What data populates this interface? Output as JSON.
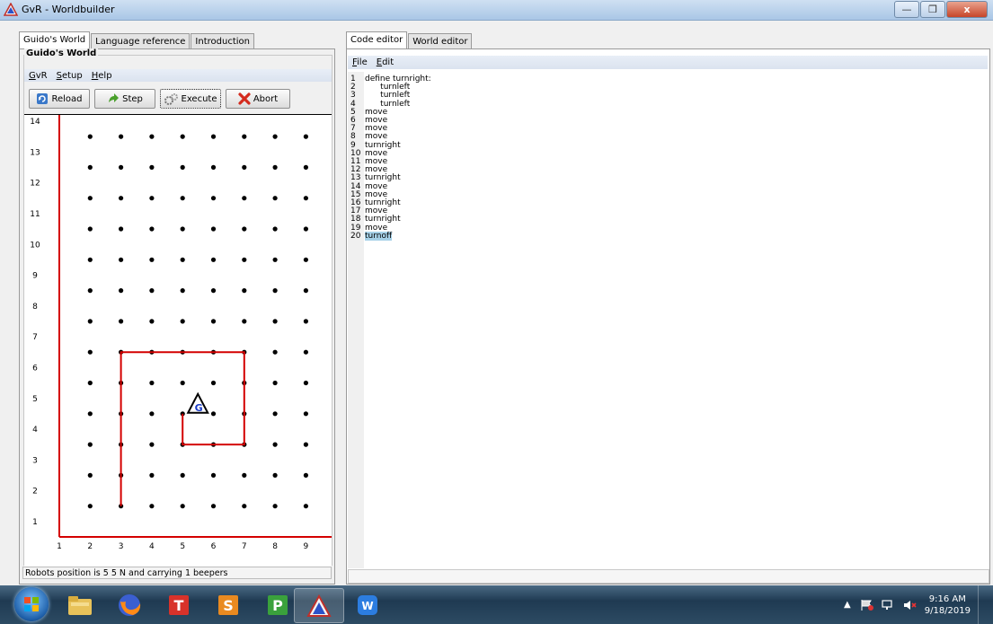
{
  "window": {
    "title": "GvR - Worldbuilder",
    "controls": [
      "—",
      "❒",
      "x"
    ]
  },
  "left_tabs": [
    {
      "label": "Guido's World",
      "active": true
    },
    {
      "label": "Language reference",
      "active": false
    },
    {
      "label": "Introduction",
      "active": false
    }
  ],
  "world_group": {
    "title": "Guido's World",
    "menu": [
      "GvR",
      "Setup",
      "Help"
    ],
    "toolbar": {
      "reload": "Reload",
      "step": "Step",
      "execute": "Execute",
      "abort": "Abort"
    },
    "grid": {
      "x_labels": [
        "1",
        "2",
        "3",
        "4",
        "5",
        "6",
        "7",
        "8",
        "9"
      ],
      "y_labels": [
        "1",
        "2",
        "3",
        "4",
        "5",
        "6",
        "7",
        "8",
        "9",
        "10",
        "11",
        "12",
        "13",
        "14"
      ],
      "robot_label": "G",
      "robot_heading": "N",
      "robot_position": [
        5,
        5
      ],
      "path": [
        [
          3,
          2
        ],
        [
          3,
          7
        ],
        [
          7,
          7
        ],
        [
          7,
          4
        ],
        [
          5,
          4
        ],
        [
          5,
          5
        ]
      ],
      "wall_color": "#d40000",
      "robot_letter_color": "#1a3cc8"
    },
    "status": "Robots position is 5 5 N and carrying 1 beepers"
  },
  "right_tabs": [
    {
      "label": "Code editor",
      "active": true
    },
    {
      "label": "World editor",
      "active": false
    }
  ],
  "editor": {
    "menu": [
      "File",
      "Edit"
    ],
    "lines": [
      {
        "num": "1",
        "text": "define turnright:"
      },
      {
        "num": "2",
        "text": "      turnleft"
      },
      {
        "num": "3",
        "text": "      turnleft"
      },
      {
        "num": "4",
        "text": "      turnleft"
      },
      {
        "num": "5",
        "text": "move"
      },
      {
        "num": "6",
        "text": "move"
      },
      {
        "num": "7",
        "text": "move"
      },
      {
        "num": "8",
        "text": "move"
      },
      {
        "num": "9",
        "text": "turnright"
      },
      {
        "num": "10",
        "text": "move"
      },
      {
        "num": "11",
        "text": "move"
      },
      {
        "num": "12",
        "text": "move"
      },
      {
        "num": "13",
        "text": "turnright"
      },
      {
        "num": "14",
        "text": "move"
      },
      {
        "num": "15",
        "text": "move"
      },
      {
        "num": "16",
        "text": "turnright"
      },
      {
        "num": "17",
        "text": "move"
      },
      {
        "num": "18",
        "text": "turnright"
      },
      {
        "num": "19",
        "text": "move"
      },
      {
        "num": "20",
        "text": "turnoff",
        "highlight": true
      }
    ]
  },
  "taskbar": {
    "apps": [
      "start-icon",
      "file-explorer-icon",
      "firefox-icon",
      "t-app-icon",
      "s-app-icon",
      "p-app-icon",
      "gvr-icon",
      "w-app-icon"
    ],
    "time": "9:16 AM",
    "date": "9/18/2019"
  }
}
